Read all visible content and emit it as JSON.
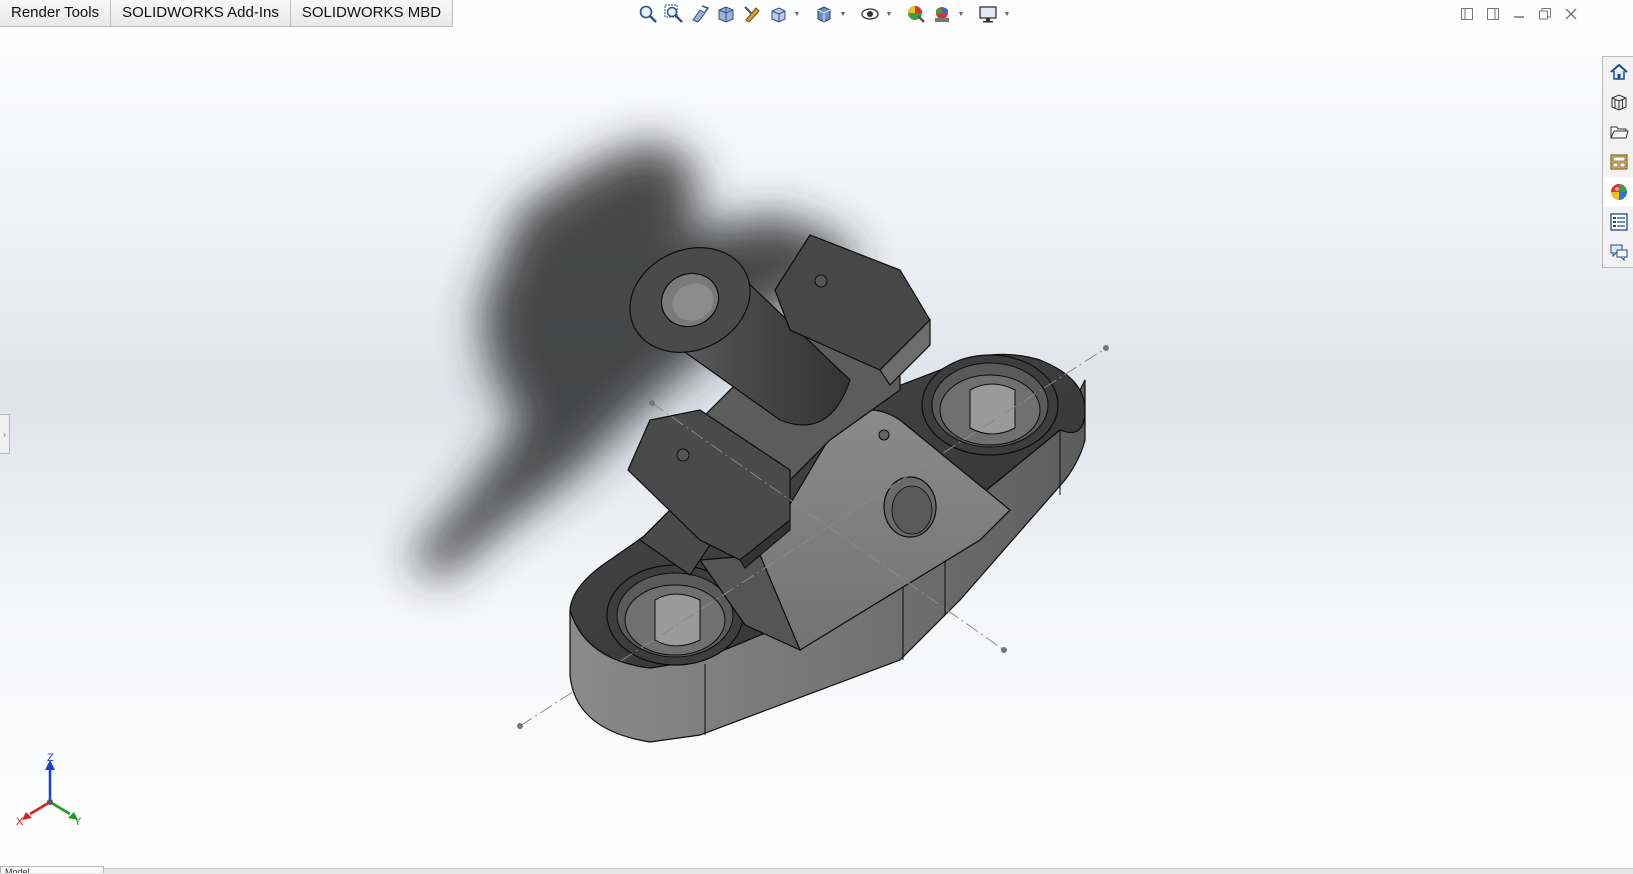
{
  "command_tabs": [
    {
      "label": "Render Tools"
    },
    {
      "label": "SOLIDWORKS Add-Ins"
    },
    {
      "label": "SOLIDWORKS MBD"
    }
  ],
  "heads_up_toolbar": [
    "zoom-to-fit-icon",
    "zoom-to-area-icon",
    "previous-view-icon",
    "section-view-icon",
    "dynamic-annotation-icon",
    "view-orientation-icon",
    "display-style-icon",
    "hide-show-items-icon",
    "edit-appearance-icon",
    "apply-scene-icon",
    "view-settings-icon"
  ],
  "task_pane": [
    "home-icon",
    "design-library-icon",
    "file-explorer-icon",
    "view-palette-icon",
    "appearances-icon",
    "custom-properties-icon",
    "forum-icon"
  ],
  "triad": {
    "x": "X",
    "y": "Y",
    "z": "Z"
  },
  "bottom_tab": {
    "label": "Model"
  },
  "colors": {
    "part_light": "#7d7d7d",
    "part_mid": "#5a5a5a",
    "part_dark": "#3a3a3a",
    "edge": "#0d0d0d",
    "axis_x": "#d62020",
    "axis_y": "#1f9a1f",
    "axis_z": "#1d3fd6"
  }
}
